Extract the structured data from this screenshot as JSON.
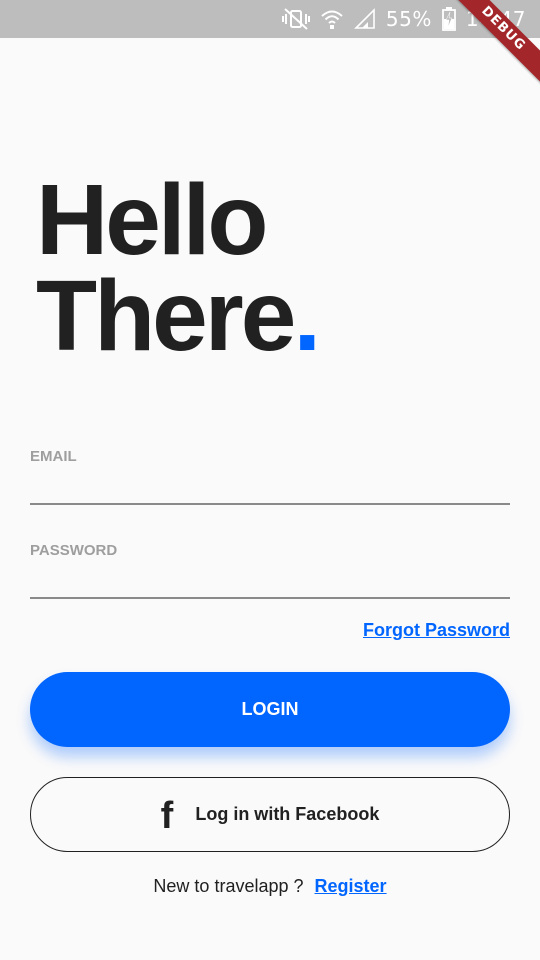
{
  "status_bar": {
    "battery_percent": "55%",
    "time": "14:47"
  },
  "debug_banner": {
    "label": "DEBUG"
  },
  "headline": {
    "line1": "Hello",
    "line2": "There",
    "dot": "."
  },
  "form": {
    "email": {
      "label": "EMAIL",
      "value": ""
    },
    "password": {
      "label": "PASSWORD",
      "value": ""
    },
    "forgot_password": "Forgot Password"
  },
  "buttons": {
    "login": "LOGIN",
    "facebook_icon": "f",
    "facebook": "Log in with Facebook"
  },
  "register": {
    "prompt": "New to travelapp ?",
    "link": "Register"
  },
  "colors": {
    "accent": "#0165ff",
    "text": "#212121",
    "label": "#9e9e9e",
    "background": "#fafafa",
    "status_bar": "#bdbdbd",
    "debug_banner": "#a3262a"
  },
  "icons": [
    "vibrate-mute-icon",
    "wifi-icon",
    "cell-signal-icon",
    "battery-charging-icon",
    "facebook-icon"
  ]
}
